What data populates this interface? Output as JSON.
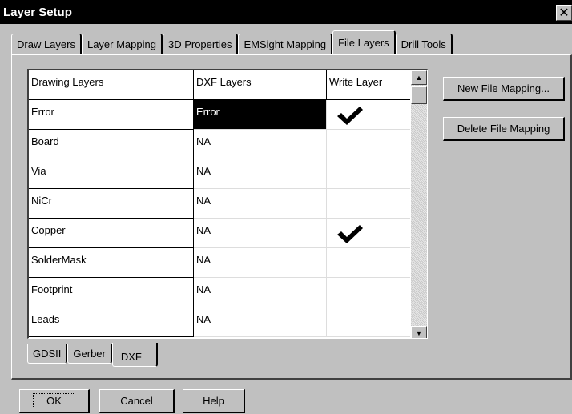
{
  "window": {
    "title": "Layer Setup",
    "close_glyph": "✕"
  },
  "tabs": [
    {
      "label": "Draw Layers"
    },
    {
      "label": "Layer Mapping"
    },
    {
      "label": "3D Properties"
    },
    {
      "label": "EMSight Mapping"
    },
    {
      "label": "File Layers",
      "active": true
    },
    {
      "label": "Drill Tools"
    }
  ],
  "grid": {
    "columns": [
      "Drawing Layers",
      "DXF Layers",
      "Write Layer"
    ],
    "rows": [
      {
        "drawing": "Error",
        "dxf": "Error",
        "write": true,
        "selected": true
      },
      {
        "drawing": "Board",
        "dxf": "NA",
        "write": false
      },
      {
        "drawing": "Via",
        "dxf": "NA",
        "write": false
      },
      {
        "drawing": "NiCr",
        "dxf": "NA",
        "write": false
      },
      {
        "drawing": "Copper",
        "dxf": "NA",
        "write": true
      },
      {
        "drawing": "SolderMask",
        "dxf": "NA",
        "write": false
      },
      {
        "drawing": "Footprint",
        "dxf": "NA",
        "write": false
      },
      {
        "drawing": "Leads",
        "dxf": "NA",
        "write": false
      }
    ],
    "scroll_up_glyph": "▲",
    "scroll_down_glyph": "▼"
  },
  "format_tabs": [
    {
      "label": "GDSII"
    },
    {
      "label": "Gerber"
    },
    {
      "label": "DXF",
      "active": true
    }
  ],
  "side_buttons": {
    "new_mapping": "New File Mapping...",
    "delete_mapping": "Delete File Mapping"
  },
  "footer": {
    "ok": "OK",
    "cancel": "Cancel",
    "help": "Help"
  },
  "icons": {
    "check": "checkmark-icon",
    "close": "close-icon"
  }
}
